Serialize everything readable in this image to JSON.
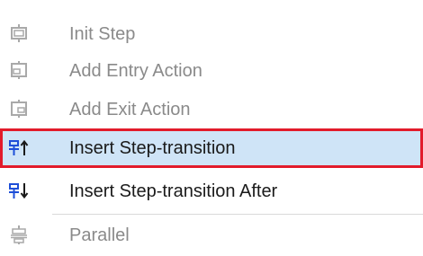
{
  "menu": {
    "items": [
      {
        "label": "Init Step",
        "icon": "init-step-icon",
        "enabled": false
      },
      {
        "label": "Add Entry Action",
        "icon": "add-entry-action-icon",
        "enabled": false
      },
      {
        "label": "Add Exit Action",
        "icon": "add-exit-action-icon",
        "enabled": false
      },
      {
        "label": "Insert Step-transition",
        "icon": "insert-step-transition-icon",
        "enabled": true,
        "highlighted": true
      },
      {
        "label": "Insert Step-transition After",
        "icon": "insert-step-transition-after-icon",
        "enabled": true
      },
      {
        "label": "Parallel",
        "icon": "parallel-icon",
        "enabled": false
      }
    ]
  },
  "colors": {
    "highlight_background": "#cfe4f7",
    "highlight_border": "#e21b2b",
    "icon_accent": "#1e4fd8",
    "disabled_icon": "#a9a9a9",
    "disabled_text": "#8a8a8a"
  }
}
